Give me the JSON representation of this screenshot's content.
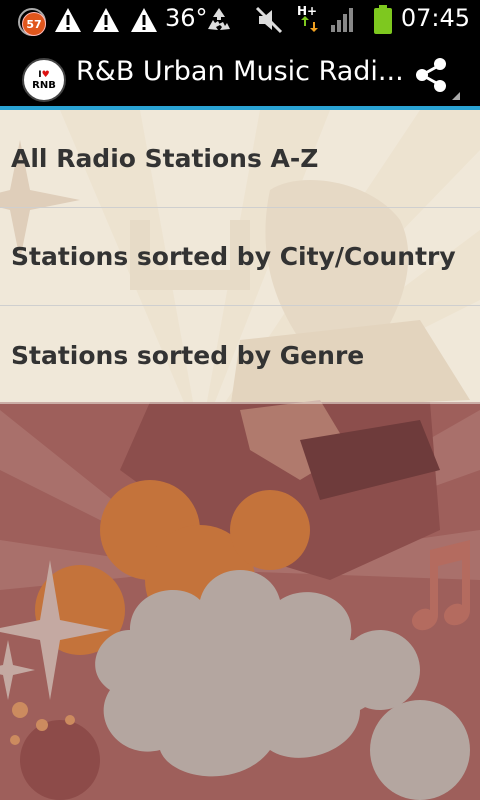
{
  "status_bar": {
    "notification_count": "57",
    "temperature": "36°",
    "network": "H+",
    "time": "07:45",
    "icons": [
      "notification-badge-icon",
      "warning-icon",
      "warning-icon",
      "warning-icon",
      "recycle-icon",
      "mute-icon",
      "hplus-data-icon",
      "signal-icon",
      "battery-icon"
    ]
  },
  "action_bar": {
    "logo_text_top": "I",
    "logo_text_bottom": "RNB",
    "title": "R&B Urban Music Radi...",
    "share_icon": "share-icon",
    "accent_color": "#2aa3d4"
  },
  "menu": {
    "items": [
      {
        "label": "All Radio Stations A-Z"
      },
      {
        "label": "Stations sorted by City/Country"
      },
      {
        "label": "Stations sorted by Genre"
      }
    ]
  },
  "colors": {
    "background_light": "#f1e6d3",
    "background_maroon": "#9a5d5a",
    "accent_orange": "#c9763d"
  }
}
